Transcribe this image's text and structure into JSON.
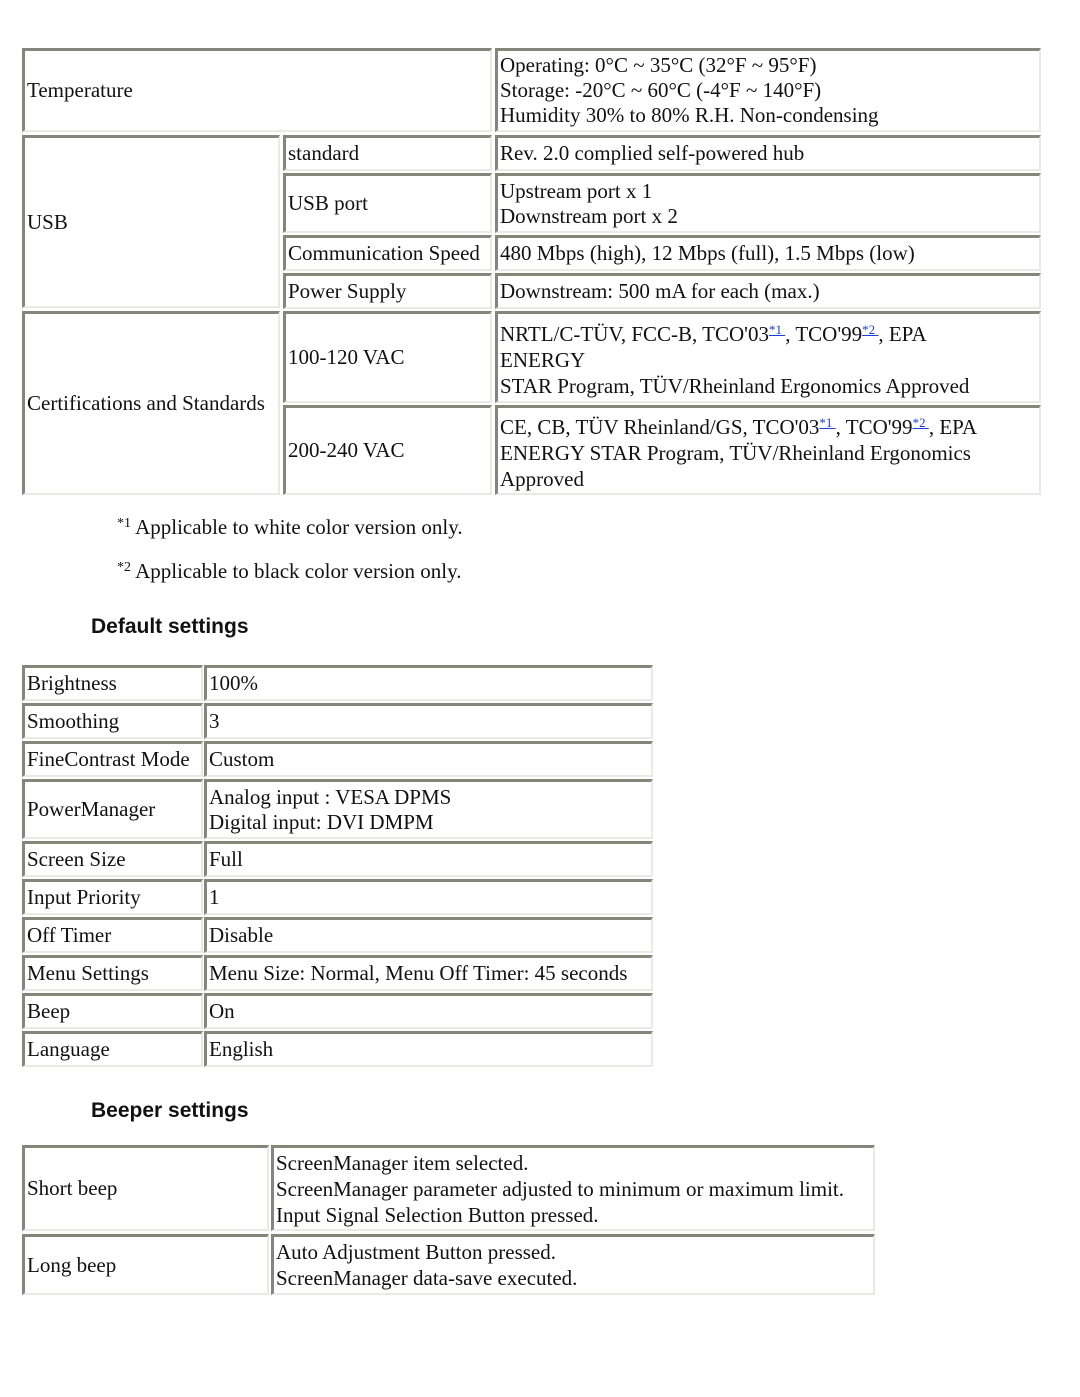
{
  "specs": {
    "temperature": {
      "label": "Temperature",
      "lines": [
        "Operating: 0°C ~ 35°C (32°F ~ 95°F)",
        "Storage: -20°C ~ 60°C (-4°F ~ 140°F)",
        "Humidity 30% to 80% R.H. Non-condensing"
      ]
    },
    "usb": {
      "label": "USB",
      "rows": [
        {
          "label": "standard",
          "lines": [
            "Rev. 2.0 complied self-powered hub"
          ]
        },
        {
          "label": "USB port",
          "lines": [
            "Upstream port x 1",
            "Downstream port x 2"
          ]
        },
        {
          "label": "Communication Speed",
          "lines": [
            "480 Mbps (high), 12 Mbps (full), 1.5 Mbps (low)"
          ]
        },
        {
          "label": "Power Supply",
          "lines": [
            "Downstream: 500 mA for each (max.)"
          ]
        }
      ]
    },
    "certifications": {
      "label": "Certifications and Standards",
      "rows": [
        {
          "label": "100-120 VAC",
          "prefix": "NRTL/C-TÜV, FCC-B, TCO'03",
          "ref1": "*1",
          "mid": ", TCO'99",
          "ref2": "*2",
          "suffix": ", EPA",
          "line2": "ENERGY",
          "line3": "STAR Program, TÜV/Rheinland Ergonomics Approved"
        },
        {
          "label": "200-240 VAC",
          "prefix": "CE, CB, TÜV Rheinland/GS, TCO'03",
          "ref1": "*1",
          "mid": ", TCO'99",
          "ref2": "*2",
          "suffix": ", EPA",
          "line2": "ENERGY STAR Program, TÜV/Rheinland Ergonomics",
          "line3": "Approved"
        }
      ]
    }
  },
  "footnotes": [
    {
      "mark": "*1",
      "text": "Applicable to white color version only."
    },
    {
      "mark": "*2",
      "text": "Applicable to black color version only."
    }
  ],
  "default_settings": {
    "heading": "Default settings",
    "rows": [
      {
        "label": "Brightness",
        "value": "100%"
      },
      {
        "label": "Smoothing",
        "value": "3"
      },
      {
        "label": "FineContrast Mode",
        "value": "Custom"
      },
      {
        "label": "PowerManager",
        "lines": [
          "Analog input : VESA DPMS",
          "Digital input: DVI DMPM"
        ]
      },
      {
        "label": "Screen Size",
        "value": "Full"
      },
      {
        "label": "Input Priority",
        "value": "1"
      },
      {
        "label": "Off Timer",
        "value": "Disable"
      },
      {
        "label": "Menu Settings",
        "value": "Menu Size: Normal, Menu Off Timer: 45 seconds"
      },
      {
        "label": "Beep",
        "value": "On"
      },
      {
        "label": "Language",
        "value": "English"
      }
    ]
  },
  "beeper_settings": {
    "heading": "Beeper settings",
    "rows": [
      {
        "label": "Short beep",
        "lines": [
          "ScreenManager item selected.",
          "ScreenManager parameter adjusted to minimum or maximum limit.",
          "Input Signal Selection Button pressed."
        ]
      },
      {
        "label": "Long beep",
        "lines": [
          "Auto Adjustment Button pressed.",
          "ScreenManager data-save executed."
        ]
      }
    ]
  },
  "colors": {
    "link": "#1a3cd8",
    "border_dark": "#878579",
    "border_light": "#e9e9e6"
  }
}
